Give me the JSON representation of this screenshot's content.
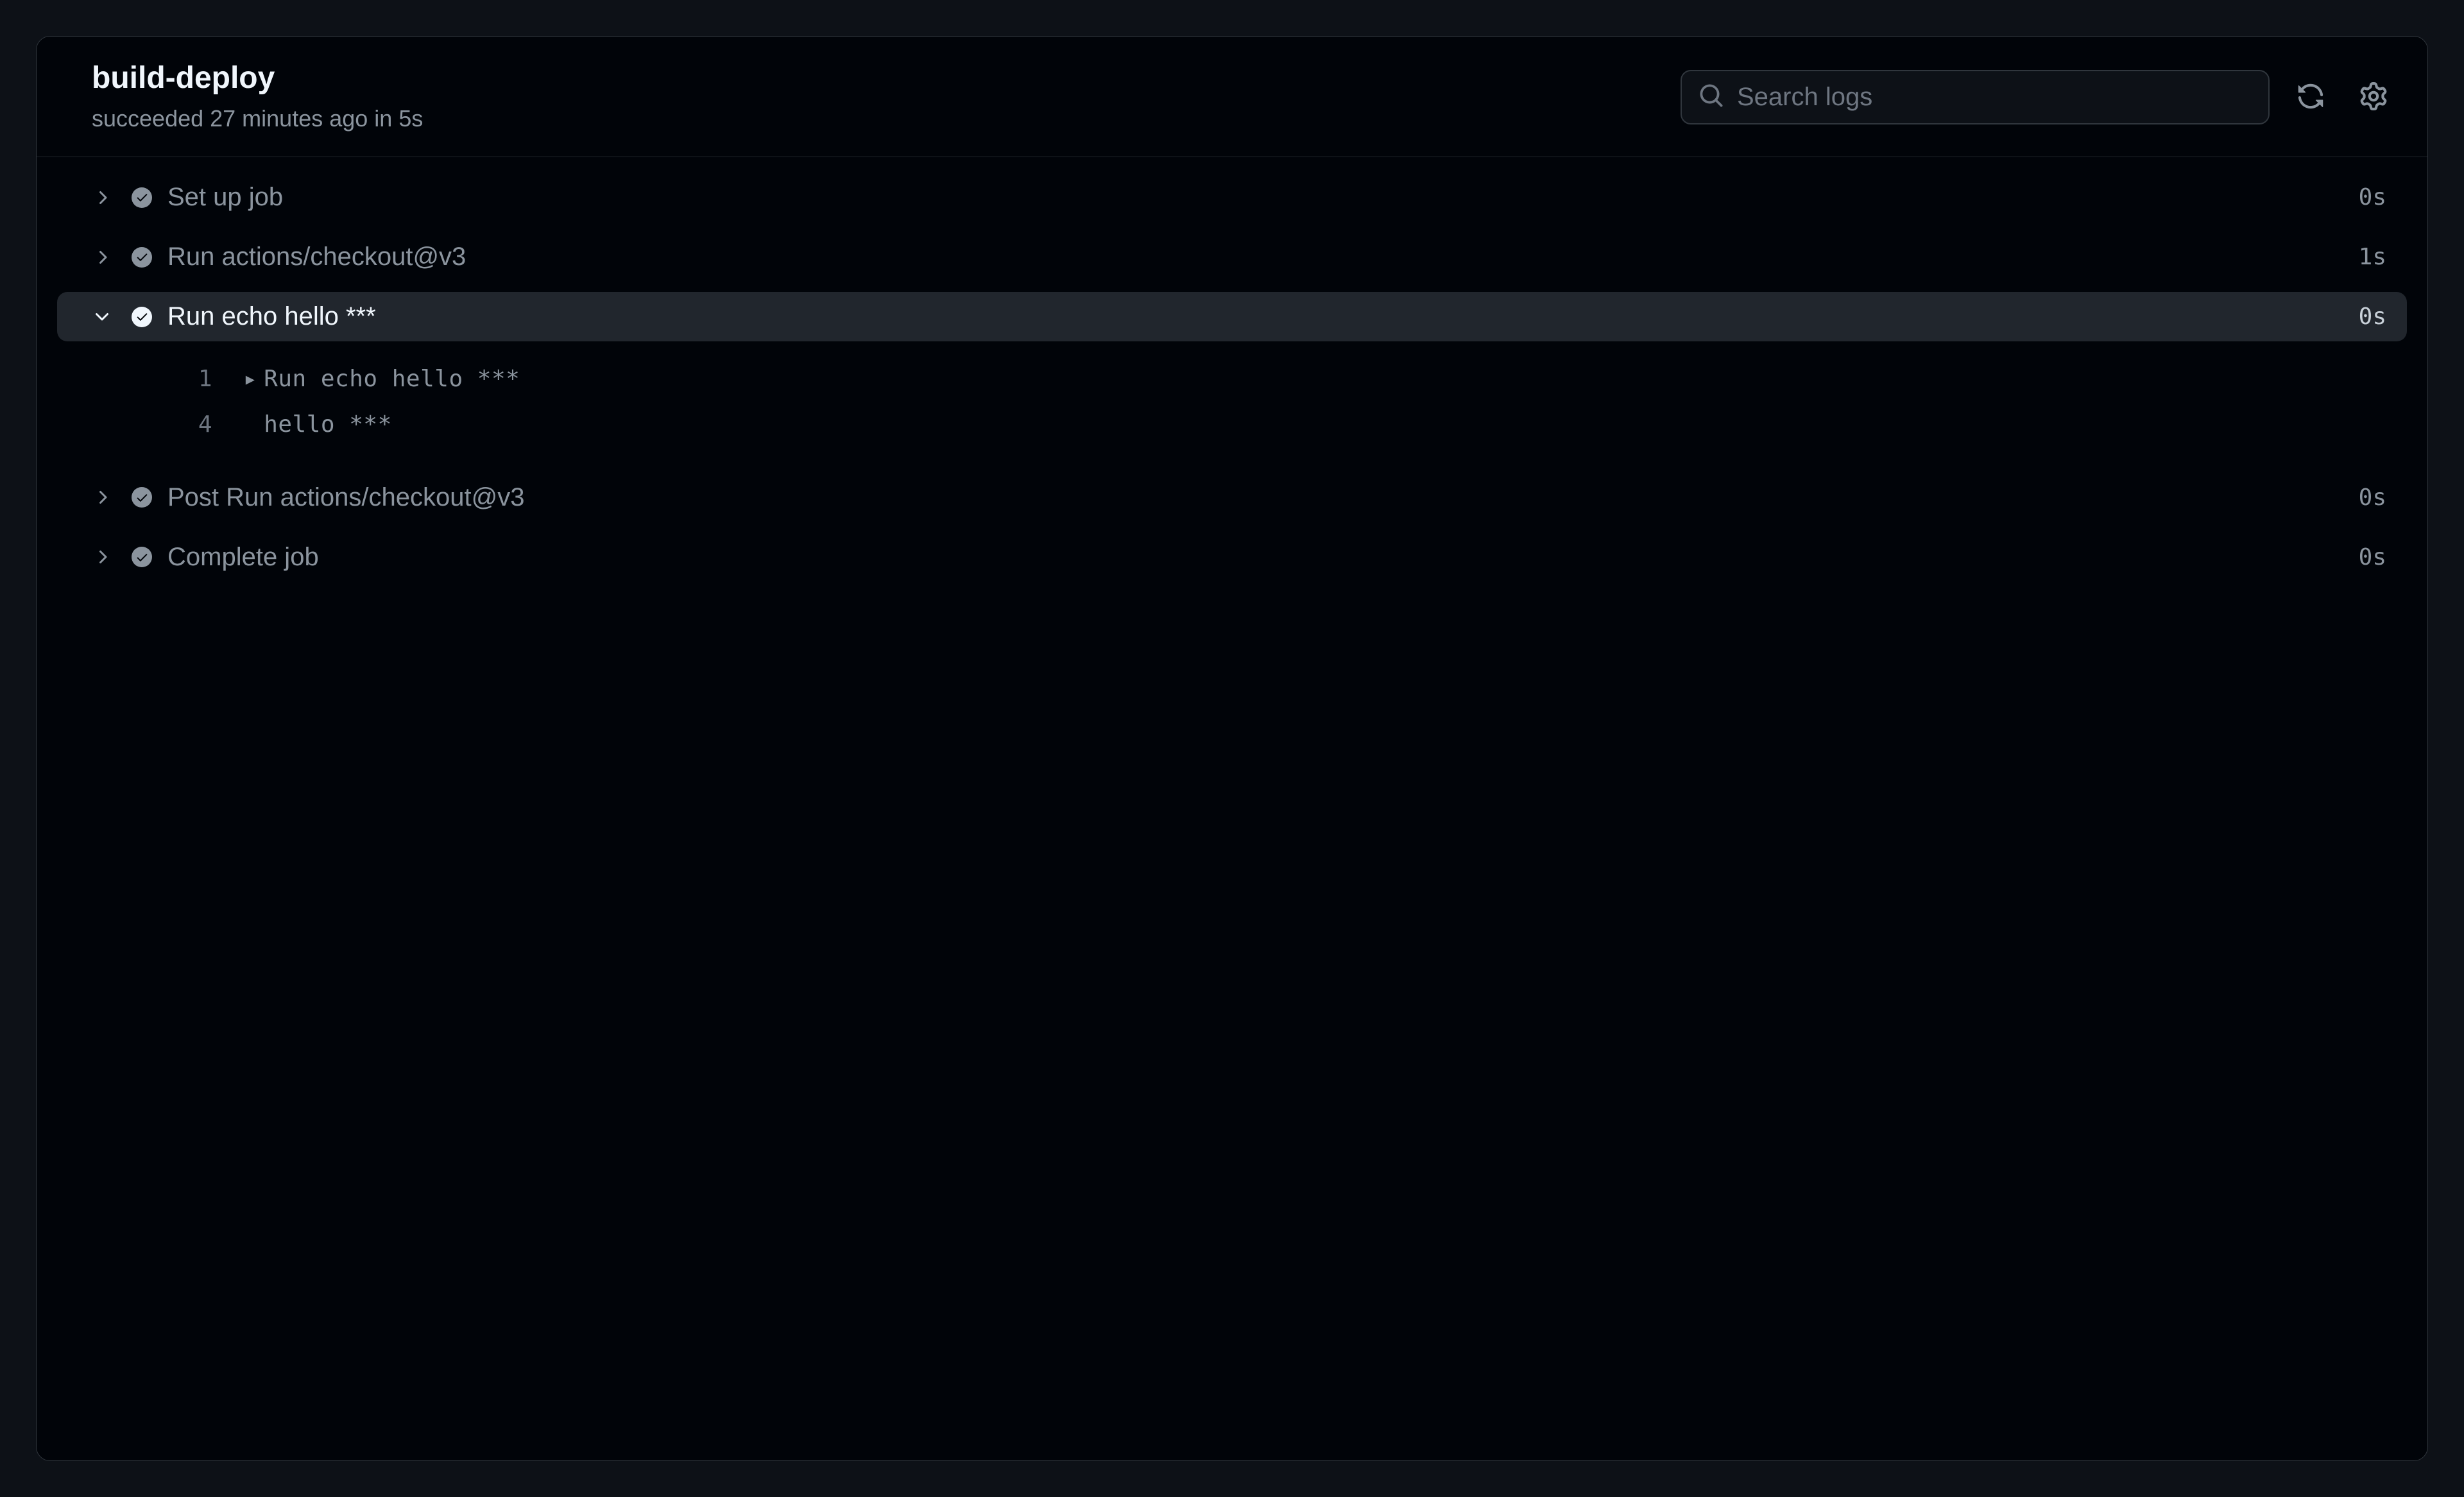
{
  "header": {
    "title": "build-deploy",
    "subtitle": "succeeded 27 minutes ago in 5s",
    "search_placeholder": "Search logs"
  },
  "steps": [
    {
      "name": "Set up job",
      "duration": "0s",
      "expanded": false
    },
    {
      "name": "Run actions/checkout@v3",
      "duration": "1s",
      "expanded": false
    },
    {
      "name": "Run echo hello ***",
      "duration": "0s",
      "expanded": true
    },
    {
      "name": "Post Run actions/checkout@v3",
      "duration": "0s",
      "expanded": false
    },
    {
      "name": "Complete job",
      "duration": "0s",
      "expanded": false
    }
  ],
  "log_lines": [
    {
      "number": "1",
      "has_marker": true,
      "content": "Run echo hello ***"
    },
    {
      "number": "4",
      "has_marker": false,
      "content": "hello ***"
    }
  ]
}
